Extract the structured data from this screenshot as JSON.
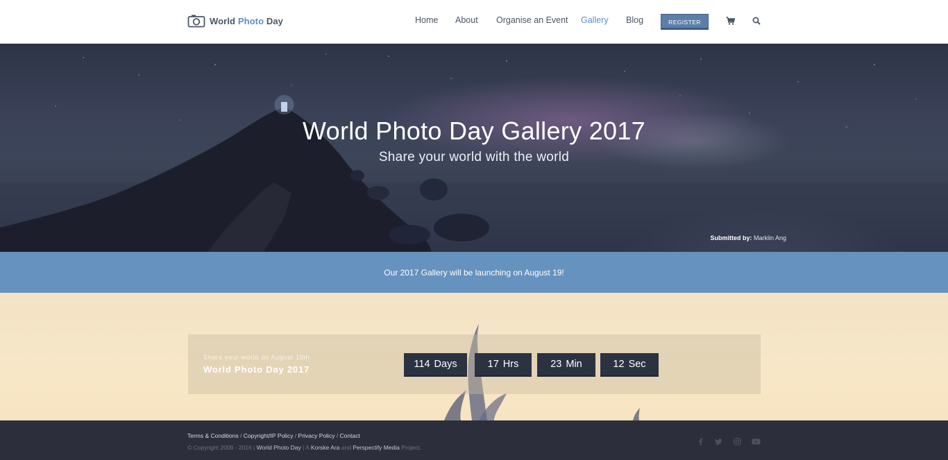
{
  "header": {
    "logo": {
      "text_main": "World ",
      "text_accent": "Photo",
      "text_end": " Day"
    },
    "nav": [
      {
        "label": "Home"
      },
      {
        "label": "About"
      },
      {
        "label": "Organise an Event"
      },
      {
        "label": "Gallery",
        "active": true
      },
      {
        "label": "Blog"
      }
    ],
    "register_label": "REGISTER",
    "icons": [
      "cart-icon",
      "search-icon"
    ]
  },
  "hero": {
    "title": "World Photo Day Gallery 2017",
    "subtitle": "Share your world with the world",
    "submitted_label": "Submitted by:",
    "submitted_name": "Marklin Ang"
  },
  "notice": {
    "text": "Our 2017 Gallery will be launching on August 19!"
  },
  "countdown": {
    "kicker": "Share your world on August 19th",
    "title": "World Photo Day 2017",
    "units": [
      {
        "value": "114",
        "label": "Days"
      },
      {
        "value": "17",
        "label": "Hrs"
      },
      {
        "value": "23",
        "label": "Min"
      },
      {
        "value": "12",
        "label": "Sec"
      }
    ]
  },
  "footer": {
    "links": [
      "Terms & Conditions",
      "Copyright/IP Policy",
      "Privacy Policy",
      "Contact"
    ],
    "copyright_prefix": "© Copyright 2009 - 2016 | ",
    "copyright_site": "World Photo Day",
    "copyright_mid1": " | A ",
    "copyright_org1": "Korske Ara",
    "copyright_mid2": " and ",
    "copyright_org2": "Perspectify Media",
    "copyright_end": " Project.",
    "social": [
      "facebook-icon",
      "twitter-icon",
      "instagram-icon",
      "youtube-icon"
    ]
  },
  "colors": {
    "accent": "#5b8fc4",
    "register_bg": "#5b7fa8",
    "notice_bg": "#6592be",
    "countdown_tile": "#2b3242",
    "footer_bg": "#2c2f3b"
  }
}
